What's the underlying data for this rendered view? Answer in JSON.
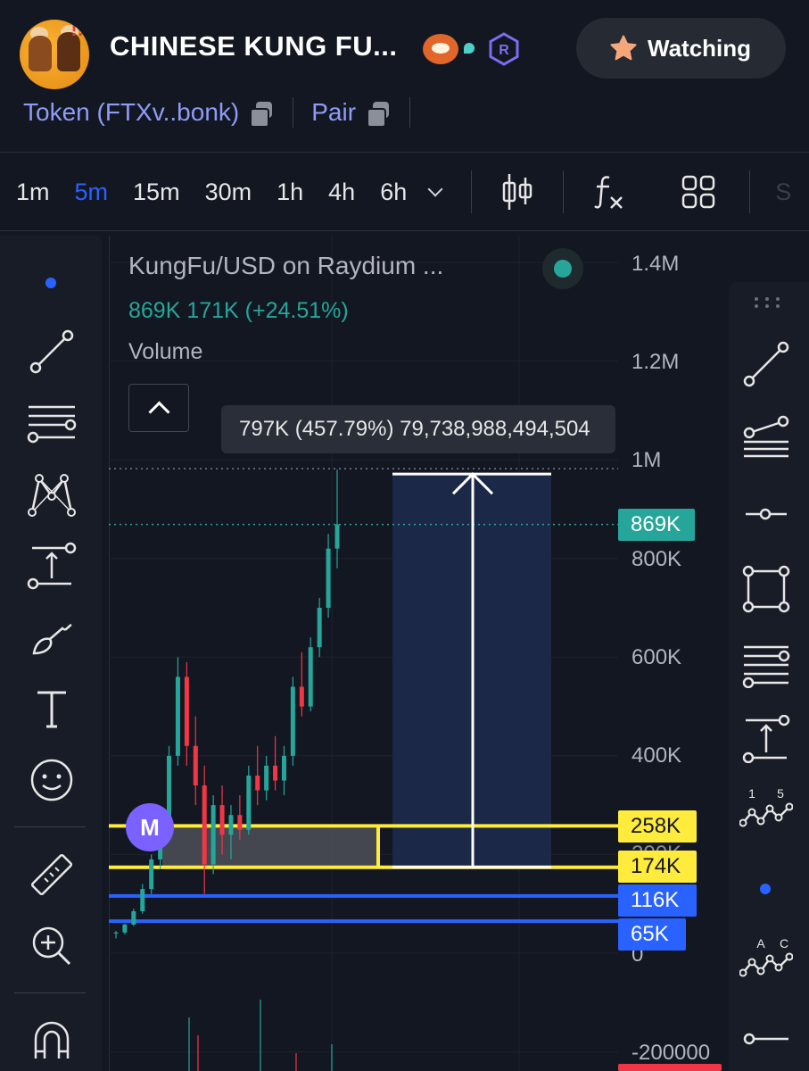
{
  "header": {
    "title": "CHINESE KUNG FU...",
    "watch_label": "Watching",
    "token_label": "Token (FTXv..bonk)",
    "pair_label": "Pair"
  },
  "timeframes": [
    "1m",
    "5m",
    "15m",
    "30m",
    "1h",
    "4h",
    "6h"
  ],
  "active_timeframe": "5m",
  "toolbar_partial": "S",
  "legend": {
    "title": "KungFu/USD on Raydium ...",
    "values": "869K  171K (+24.51%)",
    "volume_label": "Volume"
  },
  "tooltip": "797K (457.79%) 79,738,988,494,504",
  "price_axis": {
    "labels": [
      "1.4M",
      "1.2M",
      "1M",
      "800K",
      "600K",
      "400K",
      "0",
      "-200000"
    ],
    "obscured_label": "200K"
  },
  "price_tags": {
    "current": "869K",
    "y1": "258K",
    "y2": "174K",
    "b1": "116K",
    "b2": "65K"
  },
  "marker": "M",
  "right_tools_text": {
    "elliott_1": "1",
    "elliott_5": "5",
    "abc_a": "A",
    "abc_c": "C"
  },
  "colors": {
    "background": "#131722",
    "panel": "#181c27",
    "accent": "#2962ff",
    "up": "#26a69a",
    "down": "#f23645",
    "highlight": "#ffeb3b",
    "marker": "#7b61ff"
  },
  "chart_data": {
    "type": "candlestick",
    "title": "KungFu/USD on Raydium",
    "ylim": [
      -200000,
      1400000
    ],
    "last": 869000,
    "change": 171000,
    "change_pct": 24.51,
    "levels": [
      258000,
      174000,
      116000,
      65000
    ],
    "measure_top": 971000,
    "measure_change": 797000,
    "measure_pct": 457.79,
    "candles_approx": [
      [
        40000,
        45000,
        30000,
        42000
      ],
      [
        42000,
        60000,
        38000,
        58000
      ],
      [
        58000,
        90000,
        55000,
        85000
      ],
      [
        85000,
        140000,
        80000,
        130000
      ],
      [
        130000,
        200000,
        120000,
        190000
      ],
      [
        190000,
        280000,
        170000,
        260000
      ],
      [
        260000,
        420000,
        240000,
        400000
      ],
      [
        400000,
        600000,
        380000,
        560000
      ],
      [
        560000,
        590000,
        380000,
        420000
      ],
      [
        420000,
        480000,
        300000,
        340000
      ],
      [
        340000,
        380000,
        120000,
        180000
      ],
      [
        180000,
        320000,
        160000,
        300000
      ],
      [
        300000,
        340000,
        200000,
        240000
      ],
      [
        240000,
        300000,
        190000,
        280000
      ],
      [
        280000,
        320000,
        230000,
        250000
      ],
      [
        250000,
        380000,
        240000,
        360000
      ],
      [
        360000,
        420000,
        300000,
        330000
      ],
      [
        330000,
        400000,
        310000,
        380000
      ],
      [
        380000,
        440000,
        330000,
        350000
      ],
      [
        350000,
        420000,
        320000,
        400000
      ],
      [
        400000,
        560000,
        380000,
        540000
      ],
      [
        540000,
        610000,
        480000,
        500000
      ],
      [
        500000,
        640000,
        490000,
        620000
      ],
      [
        620000,
        720000,
        600000,
        700000
      ],
      [
        700000,
        850000,
        680000,
        820000
      ],
      [
        820000,
        980000,
        780000,
        869000
      ]
    ]
  }
}
